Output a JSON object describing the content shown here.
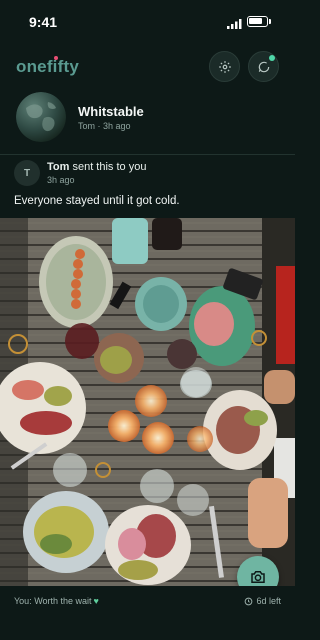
{
  "status_bar": {
    "time": "9:41"
  },
  "header": {
    "logo": "onefifty",
    "icons": [
      "settings-icon",
      "chat-bubble-icon"
    ]
  },
  "group": {
    "name": "Whitstable",
    "meta": "Tom · 3h ago"
  },
  "post": {
    "avatar_initial": "T",
    "sender_name": "Tom",
    "sender_action": " sent this to you",
    "time": "3h ago",
    "caption": "Everyone stayed until it got cold."
  },
  "footer": {
    "reply": "You: Worth the wait",
    "heart": "♥",
    "time_left": "6d left"
  },
  "colors": {
    "background": "#0d1917",
    "accent": "#6fb5a2",
    "brand_dot": "#e84f74",
    "notify": "#4ed7a8"
  }
}
